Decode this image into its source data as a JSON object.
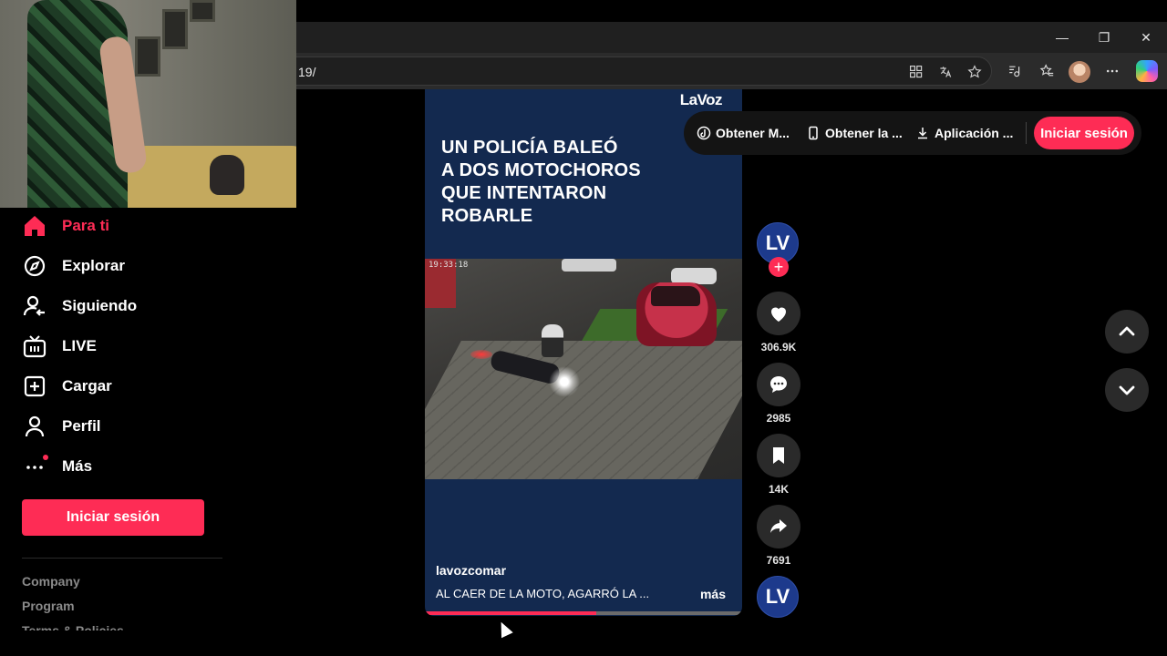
{
  "browser": {
    "url_fragment": "19/",
    "window_controls": {
      "minimize": "—",
      "restore": "❐",
      "close": "✕"
    }
  },
  "sidebar": {
    "items": [
      {
        "label": "Para ti",
        "icon": "home-icon",
        "active": true
      },
      {
        "label": "Explorar",
        "icon": "compass-icon"
      },
      {
        "label": "Siguiendo",
        "icon": "following-icon"
      },
      {
        "label": "LIVE",
        "icon": "live-icon"
      },
      {
        "label": "Cargar",
        "icon": "upload-icon"
      },
      {
        "label": "Perfil",
        "icon": "profile-icon"
      },
      {
        "label": "Más",
        "icon": "more-icon"
      }
    ],
    "login_label": "Iniciar sesión",
    "footer_links": [
      "Company",
      "Program",
      "Terms & Policies"
    ]
  },
  "top_bar": {
    "items": [
      {
        "label": "Obtener M...",
        "icon": "tiktok-coin-icon"
      },
      {
        "label": "Obtener la ...",
        "icon": "phone-icon"
      },
      {
        "label": "Aplicación ...",
        "icon": "download-icon"
      }
    ],
    "login_label": "Iniciar sesión"
  },
  "video": {
    "brand": "LaVoz",
    "headline": [
      "UN POLICÍA BALEÓ",
      "A DOS MOTOCHOROS",
      "QUE INTENTARON",
      "ROBARLE"
    ],
    "timestamp": "19:33:18",
    "username": "lavozcomar",
    "caption": "AL CAER DE LA MOTO, AGARRÓ LA ...",
    "more_label": "más",
    "progress_percent": 54
  },
  "actions": {
    "avatar_text": "LV",
    "follow_symbol": "+",
    "likes": "306.9K",
    "comments": "2985",
    "saves": "14K",
    "shares": "7691",
    "music_avatar_text": "LV"
  },
  "colors": {
    "accent": "#fe2c55",
    "video_bg": "#13294f",
    "avatar_bg": "#1d3a8c"
  }
}
